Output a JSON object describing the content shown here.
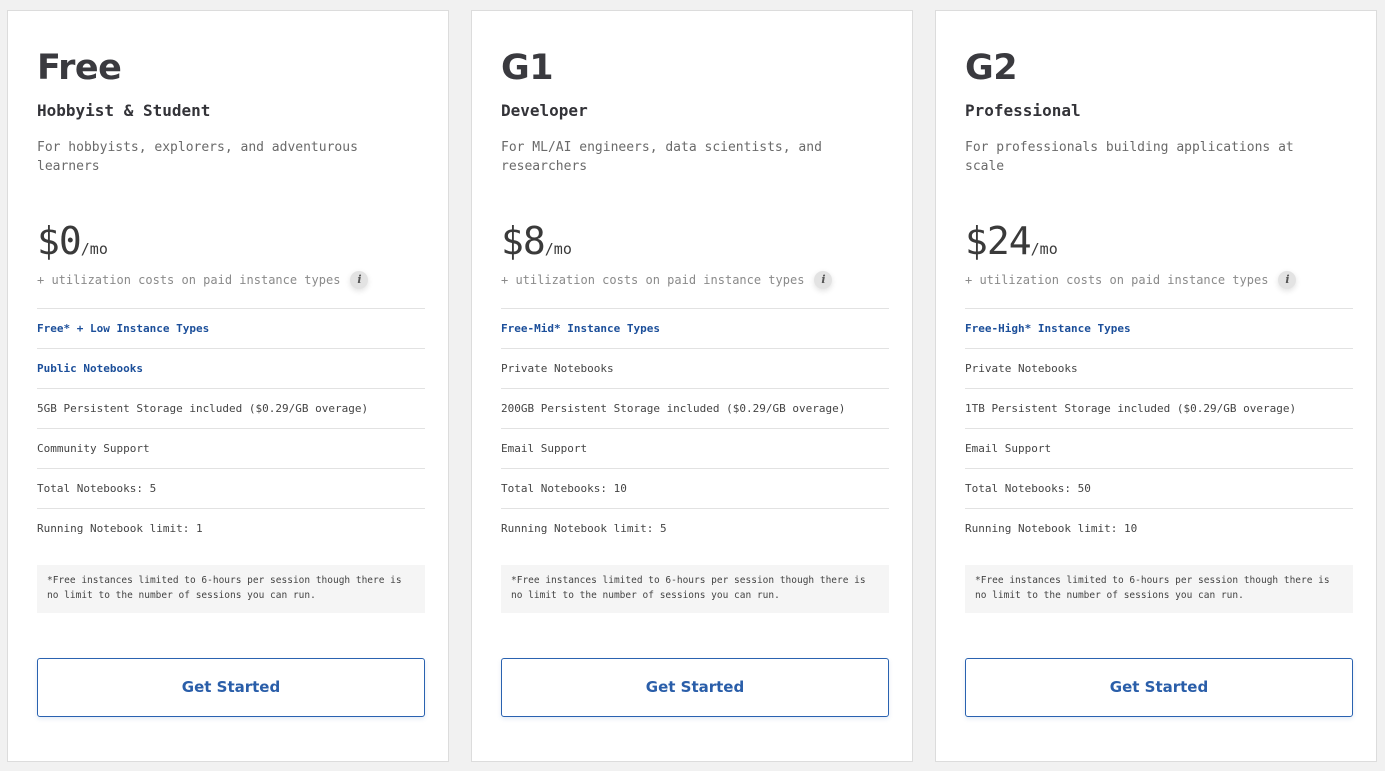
{
  "plans": [
    {
      "name": "Free",
      "tagline": "Hobbyist & Student",
      "description": "For hobbyists, explorers, and adventurous learners",
      "price": "$0",
      "per": "/mo",
      "utilization": "+ utilization costs on paid instance types",
      "info_icon": "i",
      "features": [
        "Free* + Low Instance Types",
        "Public Notebooks",
        "5GB Persistent Storage included ($0.29/GB overage)",
        "Community Support",
        "Total Notebooks: 5",
        "Running Notebook limit: 1"
      ],
      "note": "*Free instances limited to 6-hours per session though there is no limit to the number of sessions you can run.",
      "cta": "Get Started"
    },
    {
      "name": "G1",
      "tagline": "Developer",
      "description": "For ML/AI engineers, data scientists, and researchers",
      "price": "$8",
      "per": "/mo",
      "utilization": "+ utilization costs on paid instance types",
      "info_icon": "i",
      "features": [
        "Free-Mid* Instance Types",
        "Private Notebooks",
        "200GB Persistent Storage included ($0.29/GB overage)",
        "Email Support",
        "Total Notebooks: 10",
        "Running Notebook limit: 5"
      ],
      "note": "*Free instances limited to 6-hours per session though there is no limit to the number of sessions you can run.",
      "cta": "Get Started"
    },
    {
      "name": "G2",
      "tagline": "Professional",
      "description": "For professionals building applications at scale",
      "price": "$24",
      "per": "/mo",
      "utilization": "+ utilization costs on paid instance types",
      "info_icon": "i",
      "features": [
        "Free-High* Instance Types",
        "Private Notebooks",
        "1TB Persistent Storage included ($0.29/GB overage)",
        "Email Support",
        "Total Notebooks: 50",
        "Running Notebook limit: 10"
      ],
      "note": "*Free instances limited to 6-hours per session though there is no limit to the number of sessions you can run.",
      "cta": "Get Started"
    }
  ],
  "colors": {
    "accent": "#2a5ea9",
    "highlight_text": "#1c4f9a",
    "heading": "#3a3a3f",
    "muted": "#8a8a8a"
  }
}
